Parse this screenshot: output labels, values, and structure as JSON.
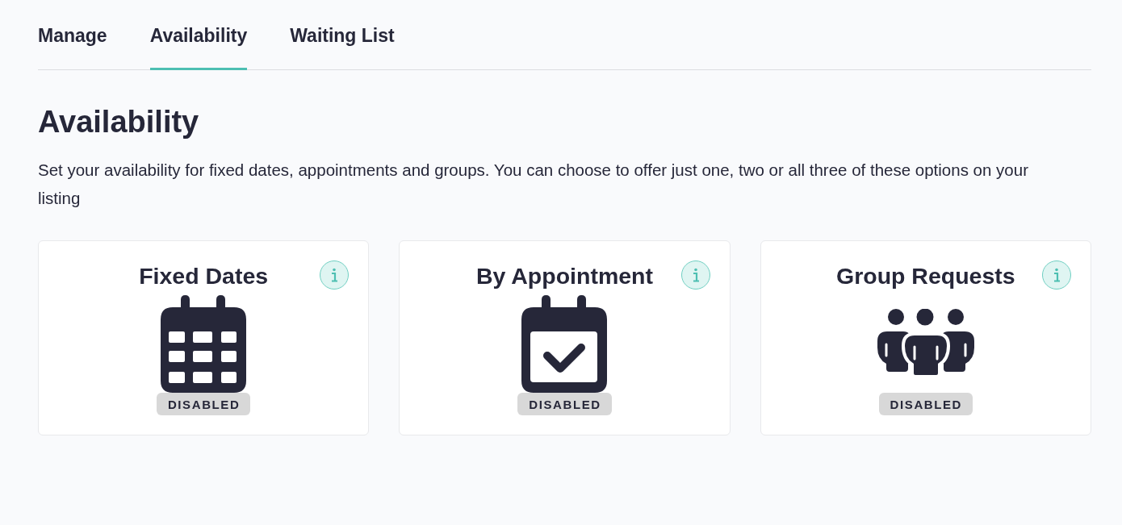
{
  "tabs": [
    {
      "label": "Manage",
      "selected": false
    },
    {
      "label": "Availability",
      "selected": true
    },
    {
      "label": "Waiting List",
      "selected": false
    }
  ],
  "heading": "Availability",
  "description": "Set your availability for fixed dates, appointments and groups. You can choose to offer just one, two or all three of these options on your listing",
  "cards": [
    {
      "kind": "calendar",
      "title": "Fixed Dates",
      "status": "DISABLED"
    },
    {
      "kind": "appointment",
      "title": "By Appointment",
      "status": "DISABLED"
    },
    {
      "kind": "group",
      "title": "Group Requests",
      "status": "DISABLED"
    }
  ]
}
